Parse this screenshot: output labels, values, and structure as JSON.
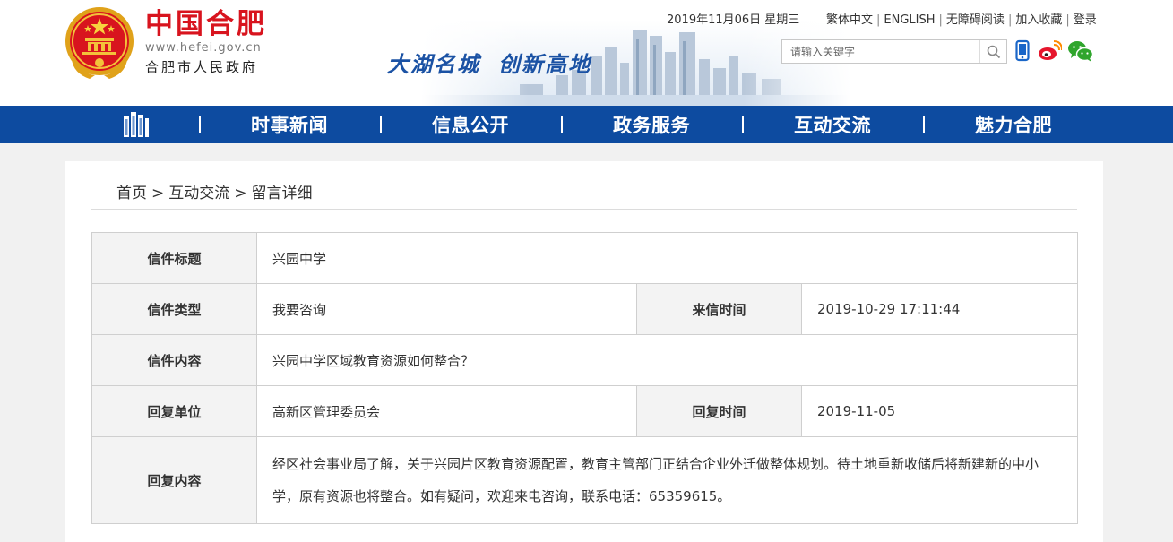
{
  "header": {
    "title": "中国合肥",
    "url": "www.hefei.gov.cn",
    "subtitle": "合肥市人民政府",
    "slogan_1": "大湖名城",
    "slogan_2": "创新高地",
    "date": "2019年11月06日 星期三",
    "links": [
      "繁体中文",
      "ENGLISH",
      "无障碍阅读",
      "加入收藏",
      "登录"
    ],
    "search_placeholder": "请输入关键字",
    "brand_color": "#d8141e",
    "nav_color": "#0d4ba0"
  },
  "nav": {
    "items": [
      "时事新闻",
      "信息公开",
      "政务服务",
      "互动交流",
      "魅力合肥"
    ]
  },
  "breadcrumb": {
    "home": "首页",
    "section": "互动交流",
    "current": "留言详细",
    "separator": ">"
  },
  "letter": {
    "title_label": "信件标题",
    "title": "兴园中学",
    "type_label": "信件类型",
    "type": "我要咨询",
    "sent_label": "来信时间",
    "sent_time": "2019-10-29 17:11:44",
    "content_label": "信件内容",
    "content": "兴园中学区域教育资源如何整合？",
    "reply_unit_label": "回复单位",
    "reply_unit": "高新区管理委员会",
    "reply_time_label": "回复时间",
    "reply_time": "2019-11-05",
    "reply_content_label": "回复内容",
    "reply_content": "经区社会事业局了解，关于兴园片区教育资源配置，教育主管部门正结合企业外迁做整体规划。待土地重新收储后将新建新的中小学，原有资源也将整合。如有疑问，欢迎来电咨询，联系电话：65359615。"
  }
}
